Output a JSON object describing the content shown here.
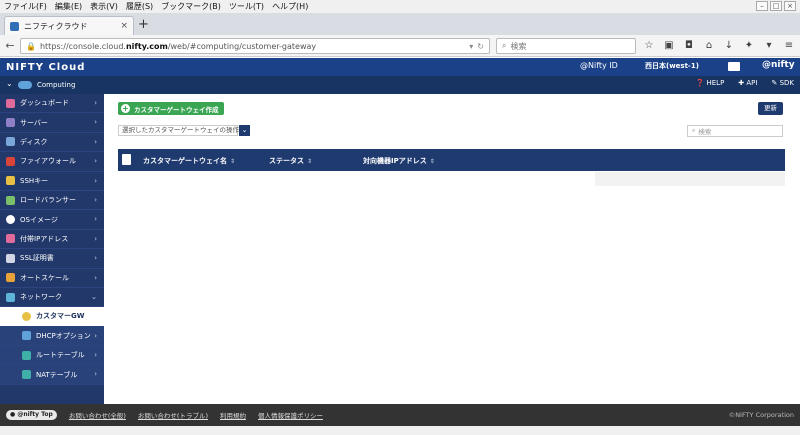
{
  "browser": {
    "menus": [
      "ファイル(F)",
      "編集(E)",
      "表示(V)",
      "履歴(S)",
      "ブックマーク(B)",
      "ツール(T)",
      "ヘルプ(H)"
    ],
    "tab_title": "ニフティクラウド",
    "url_prefix": "https://console.cloud.",
    "url_domain": "nifty.com",
    "url_path": "/web/#computing/customer-gateway",
    "search_placeholder": "検索"
  },
  "header": {
    "brand": "NIFTY Cloud",
    "user": "@Nifty ID",
    "region": "西日本(west-1)",
    "brand_right": "@nifty"
  },
  "subheader": {
    "service": "Computing",
    "links": [
      "HELP",
      "API",
      "SDK"
    ]
  },
  "sidebar": {
    "items": [
      {
        "label": "ダッシュボード",
        "color": "#e06a9a"
      },
      {
        "label": "サーバー",
        "color": "#8f7fc6"
      },
      {
        "label": "ディスク",
        "color": "#7aa6d9"
      },
      {
        "label": "ファイアウォール",
        "color": "#d9443a"
      },
      {
        "label": "SSHキー",
        "color": "#e8c045"
      },
      {
        "label": "ロードバランサー",
        "color": "#7cbf6a"
      },
      {
        "label": "OSイメージ",
        "color": "#ffffff"
      },
      {
        "label": "付帯IPアドレス",
        "color": "#e06a9a"
      },
      {
        "label": "SSL証明書",
        "color": "#d2d6e4"
      },
      {
        "label": "オートスケール",
        "color": "#e8a23a"
      },
      {
        "label": "ネットワーク",
        "color": "#5fb3d9"
      }
    ],
    "sub_items": [
      {
        "label": "カスタマーGW",
        "color": "#e8c045",
        "active": true
      },
      {
        "label": "DHCPオプション",
        "color": "#5fa3da"
      },
      {
        "label": "ルートテーブル",
        "color": "#3fb0a8"
      },
      {
        "label": "NATテーブル",
        "color": "#3fb0a8"
      }
    ]
  },
  "main": {
    "create_label": "カスタマーゲートウェイ作成",
    "refresh_label": "更新",
    "action_placeholder": "選択したカスタマーゲートウェイの操作",
    "filter_placeholder": "検索",
    "columns": [
      "カスタマーゲートウェイ名",
      "ステータス",
      "対向機器IPアドレス"
    ]
  },
  "footer": {
    "logo": "● @nifty Top",
    "links": [
      "お問い合わせ(全般)",
      "お問い合わせ(トラブル)",
      "利用規約",
      "個人情報保護ポリシー"
    ],
    "copyright": "©NIFTY Corporation"
  }
}
